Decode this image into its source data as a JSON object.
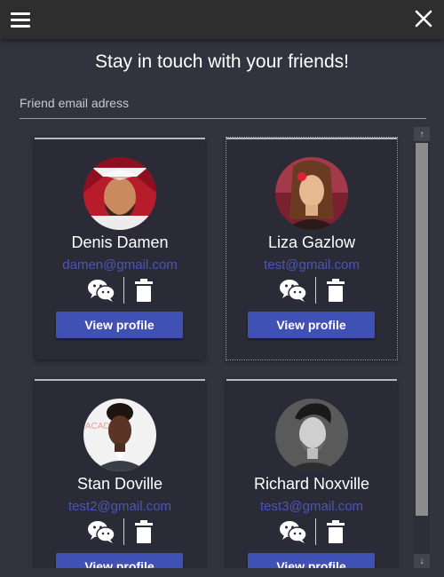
{
  "header": {
    "menu_icon": "hamburger-menu-icon",
    "close_icon": "close-icon"
  },
  "title": "Stay in touch with your friends!",
  "email_input": {
    "placeholder": "Friend email adress",
    "value": ""
  },
  "friends": [
    {
      "name": "Denis Damen",
      "email": "damen@gmail.com",
      "button": "View profile"
    },
    {
      "name": "Liza Gazlow",
      "email": "test@gmail.com",
      "button": "View profile"
    },
    {
      "name": "Stan Doville",
      "email": "test2@gmail.com",
      "button": "View profile"
    },
    {
      "name": "Richard Noxville",
      "email": "test3@gmail.com",
      "button": "View profile"
    }
  ],
  "colors": {
    "background": "#33333f",
    "topbar": "#2e2e2e",
    "card": "#2b2b38",
    "accent": "#3f51b5",
    "email_link": "#4a56b6"
  },
  "icons": {
    "chat": "wechat-chat-icon",
    "delete": "trash-icon"
  }
}
